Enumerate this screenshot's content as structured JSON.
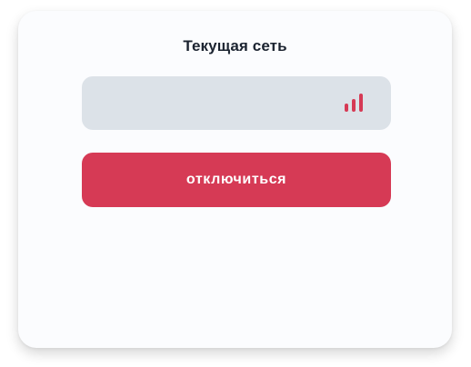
{
  "panel": {
    "title": "Текущая сеть",
    "network_name": "",
    "signal_icon": "signal-strength-icon",
    "disconnect_label": "отключиться"
  },
  "colors": {
    "accent": "#d63a55",
    "field_background": "#dce2e8",
    "card_background": "#fbfcfe",
    "title_text": "#1b2330"
  }
}
